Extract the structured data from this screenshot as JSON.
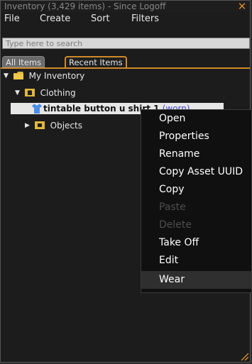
{
  "window": {
    "title": "Inventory (3,429 items) - Since Logoff"
  },
  "menubar": {
    "items": [
      "File",
      "Create",
      "Sort",
      "Filters"
    ]
  },
  "search": {
    "placeholder": "Type here to search"
  },
  "tabs": [
    {
      "label": "All Items",
      "active": false
    },
    {
      "label": "Recent Items",
      "active": true
    }
  ],
  "tree": {
    "root": "My Inventory",
    "clothing": "Clothing",
    "selected_item": "tintable button u shirt 1",
    "selected_suffix": "(worn)",
    "objects": "Objects"
  },
  "context_menu": {
    "items": [
      {
        "label": "Open",
        "enabled": true
      },
      {
        "label": "Properties",
        "enabled": true
      },
      {
        "label": "Rename",
        "enabled": true
      },
      {
        "label": "Copy Asset UUID",
        "enabled": true
      },
      {
        "label": "Copy",
        "enabled": true
      },
      {
        "label": "Paste",
        "enabled": false
      },
      {
        "label": "Delete",
        "enabled": false
      },
      {
        "label": "Take Off",
        "enabled": true
      },
      {
        "label": "Edit",
        "enabled": true
      },
      {
        "label": "Wear",
        "enabled": true,
        "highlighted": true
      }
    ]
  },
  "colors": {
    "accent": "#d08a2a",
    "folder": "#e0b83a",
    "shirt": "#4a8ee8",
    "worn": "#4a4ad0"
  },
  "icons": {
    "close": "close-icon",
    "folder": "folder-icon",
    "clothing_folder": "clothing-folder-icon",
    "objects_folder": "objects-folder-icon",
    "shirt": "shirt-icon",
    "resize": "resize-handle-icon"
  }
}
